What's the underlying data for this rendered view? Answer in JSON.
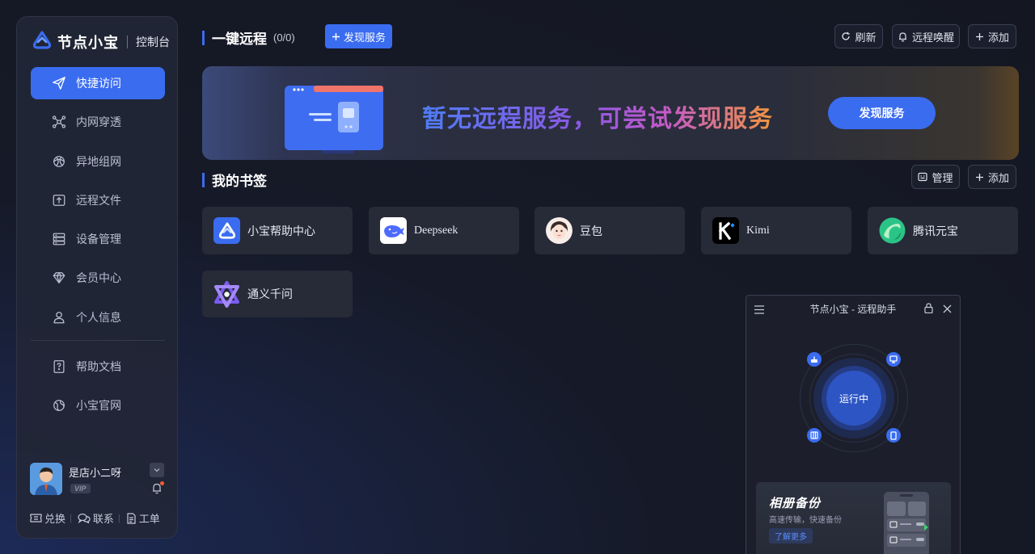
{
  "brand": {
    "name": "节点小宝",
    "subtitle": "控制台",
    "accent": "#3a6cf0"
  },
  "sidebar": {
    "items": [
      {
        "label": "快捷访问",
        "icon": "send-icon",
        "active": true
      },
      {
        "label": "内网穿透",
        "icon": "network-nodes-icon"
      },
      {
        "label": "异地组网",
        "icon": "globe-mesh-icon"
      },
      {
        "label": "远程文件",
        "icon": "folder-upload-icon"
      },
      {
        "label": "设备管理",
        "icon": "server-icon"
      },
      {
        "label": "会员中心",
        "icon": "diamond-icon"
      },
      {
        "label": "个人信息",
        "icon": "user-icon"
      }
    ],
    "secondary": [
      {
        "label": "帮助文档",
        "icon": "help-doc-icon"
      },
      {
        "label": "小宝官网",
        "icon": "website-icon"
      }
    ]
  },
  "user": {
    "name": "是店小二呀",
    "badge": "VIP",
    "links": [
      {
        "label": "兑换",
        "icon": "ticket-icon"
      },
      {
        "label": "联系",
        "icon": "chat-icon"
      },
      {
        "label": "工单",
        "icon": "document-icon"
      }
    ]
  },
  "remote": {
    "title": "一键远程",
    "count": "(0/0)",
    "discover_label": "发现服务",
    "actions": {
      "refresh": "刷新",
      "wake": "远程唤醒",
      "add": "添加"
    }
  },
  "banner": {
    "message": "暂无远程服务，可尝试发现服务",
    "button": "发现服务"
  },
  "bookmarks": {
    "title": "我的书签",
    "actions": {
      "manage": "管理",
      "add": "添加"
    },
    "items": [
      {
        "label": "小宝帮助中心",
        "icon": "xiaobao-logo-icon"
      },
      {
        "label": "Deepseek",
        "icon": "deepseek-whale-icon"
      },
      {
        "label": "豆包",
        "icon": "doubao-avatar-icon"
      },
      {
        "label": "Kimi",
        "icon": "kimi-logo-icon"
      },
      {
        "label": "腾讯元宝",
        "icon": "yuanbao-logo-icon"
      },
      {
        "label": "通义千问",
        "icon": "tongyi-logo-icon"
      }
    ]
  },
  "assistant": {
    "title": "节点小宝 - 远程助手",
    "status": "运行中",
    "promo": {
      "title": "相册备份",
      "subtitle": "高速传输，快速备份",
      "button": "了解更多"
    }
  }
}
